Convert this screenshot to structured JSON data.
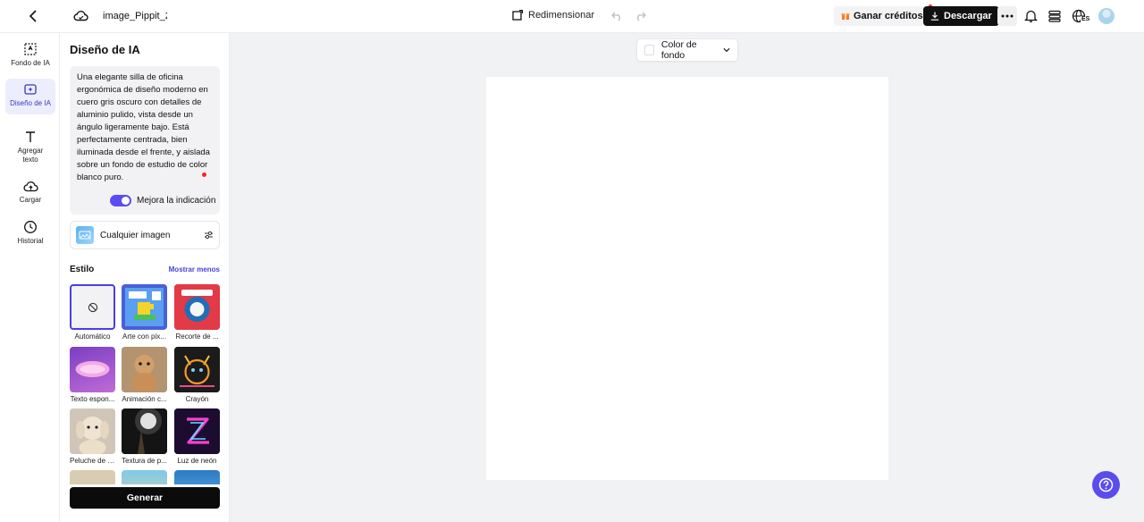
{
  "topbar": {
    "filename": "image_Pippit_20",
    "resize_label": "Redimensionar",
    "credits_label": "Ganar créditos",
    "download_label": "Descargar",
    "language_code": "ES"
  },
  "rail": {
    "items": [
      {
        "label": "Fondo de IA",
        "icon": "ai-background-icon"
      },
      {
        "label": "Diseño de IA",
        "icon": "ai-design-icon",
        "active": true
      },
      {
        "label": "Agregar texto",
        "icon": "text-icon"
      },
      {
        "label": "Cargar",
        "icon": "upload-cloud-icon"
      },
      {
        "label": "Historial",
        "icon": "clock-icon"
      }
    ]
  },
  "panel": {
    "title": "Diseño de IA",
    "prompt": "Una elegante silla de oficina ergonómica de diseño moderno en cuero gris oscuro con detalles de aluminio pulido, vista desde un ángulo ligeramente bajo. Está perfectamente centrada, bien iluminada desde el frente, y aislada sobre un fondo de estudio de color blanco puro.",
    "enhance_label": "Mejora la indicación",
    "enhance_on": true,
    "model_label": "Cualquier imagen",
    "style_label": "Estilo",
    "show_less": "Mostrar menos",
    "styles": [
      {
        "label": "Automático"
      },
      {
        "label": "Arte con pix..."
      },
      {
        "label": "Recorte de ..."
      },
      {
        "label": "Texto espon..."
      },
      {
        "label": "Animación c..."
      },
      {
        "label": "Crayón"
      },
      {
        "label": "Peluche de f..."
      },
      {
        "label": "Textura de p..."
      },
      {
        "label": "Luz de neón"
      }
    ],
    "generate_label": "Generar"
  },
  "canvas": {
    "bg_color_label": "Color de fondo"
  },
  "colors": {
    "accent": "#5b4cf0",
    "dark": "#0b0b0c"
  }
}
